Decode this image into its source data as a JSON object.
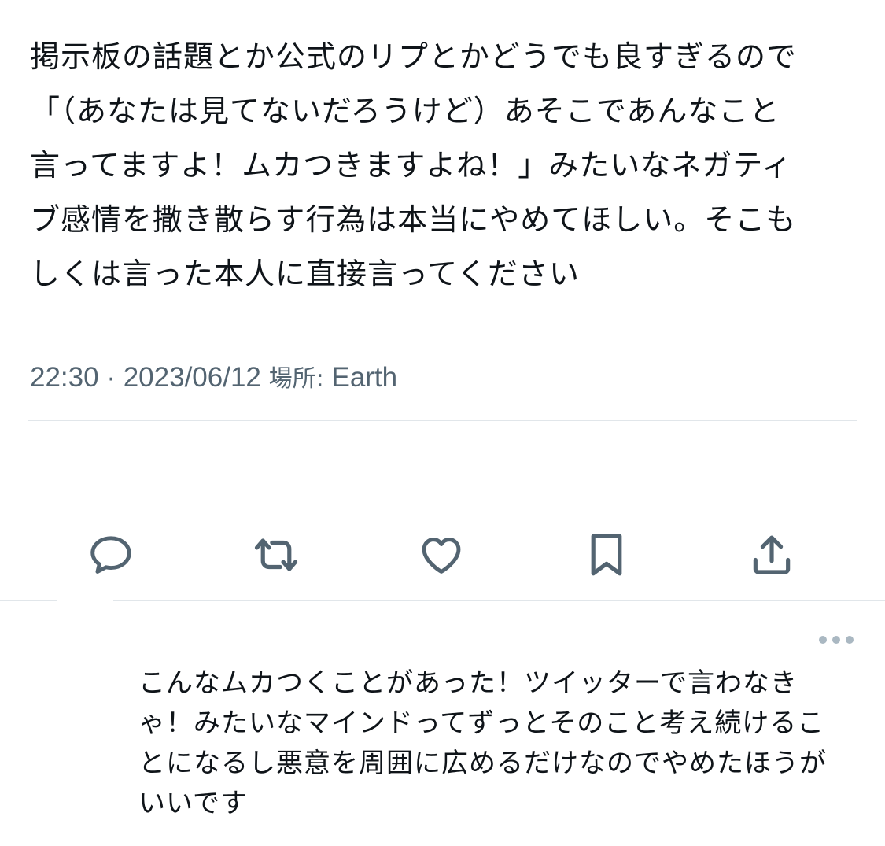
{
  "tweet": {
    "text": "掲示板の話題とか公式のリプとかどうでも良すぎるので\n「（あなたは見てないだろうけど）あそこであんなこと\n言ってますよ！ムカつきますよね！」みたいなネガティ\nブ感情を撒き散らす行為は本当にやめてほしい。そこも\nしくは言った本人に直接言ってください",
    "time": "22:30",
    "separator": "·",
    "date": "2023/06/12",
    "place_label": "場所:",
    "place_value": "Earth"
  },
  "actions": [
    {
      "name": "reply",
      "icon": "reply-icon"
    },
    {
      "name": "retweet",
      "icon": "retweet-icon"
    },
    {
      "name": "like",
      "icon": "heart-icon"
    },
    {
      "name": "bookmark",
      "icon": "bookmark-icon"
    },
    {
      "name": "share",
      "icon": "share-icon"
    }
  ],
  "reply": {
    "text": "こんなムカつくことがあった！ツイッターで言わなき\nゃ！みたいなマインドってずっとそのこと考え続けるこ\nとになるし悪意を周囲に広めるだけなのでやめたほうが\nいいです",
    "more_icon": "more-icon"
  },
  "colors": {
    "text": "#0f1419",
    "secondary": "#536471",
    "divider": "#e1e6ea",
    "more_dots": "#aab8c2"
  }
}
